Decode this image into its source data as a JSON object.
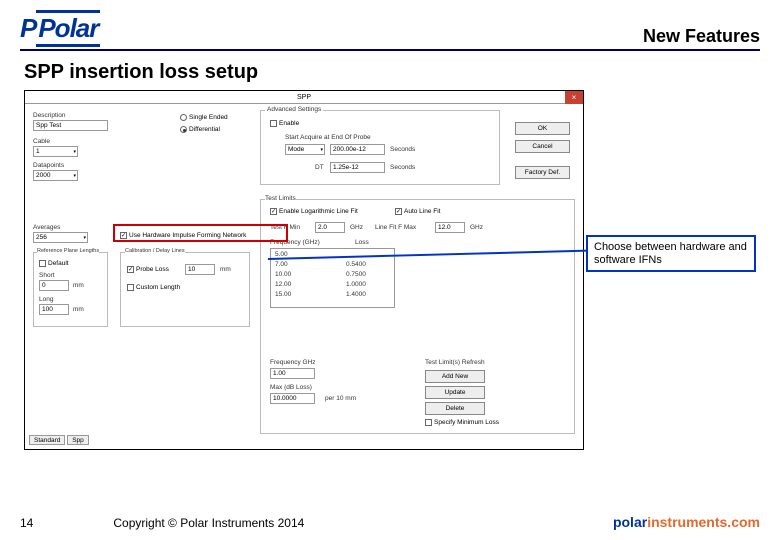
{
  "header": {
    "new_features": "New Features"
  },
  "logo_text": "Polar",
  "title": "SPP insertion loss setup",
  "dialog": {
    "title": "SPP",
    "close": "×",
    "description_label": "Description",
    "description_value": "Spp Test",
    "cable_label": "Cable",
    "cable_value": "1",
    "datapoints_label": "Datapoints",
    "datapoints_value": "2000",
    "radio_single": "Single Ended",
    "radio_diff": "Differential",
    "advanced_group": "Advanced Settings",
    "enable": "Enable",
    "start_acquire": "Start Acquire at End Of Probe",
    "mode_value": "Mode",
    "start_val": "200.00e-12",
    "seconds": "Seconds",
    "dt_label": "DT",
    "dt_value": "1.25e-12",
    "ok": "OK",
    "cancel": "Cancel",
    "factory": "Factory Def.",
    "averages_label": "Averages",
    "averages_value": "256",
    "ifn_check": "Use Hardware Impulse Forming Network",
    "refplane_group": "Reference Plane Lengths",
    "default_chk": "Default",
    "short_lbl": "Short",
    "short_val": "0",
    "long_lbl": "Long",
    "long_val": "100",
    "unit_mm": "mm",
    "calib_group": "Calibration / Delay Lines",
    "probe_loss": "Probe Loss",
    "custom_len": "Custom Length",
    "calib_val": "10",
    "testlimits_group": "Test Limits",
    "enable_logfit": "Enable Logarithmic Line Fit",
    "autoline": "Auto Line Fit",
    "testfmin": "Test F Min",
    "testfmin_val": "2.0",
    "ghz": "GHz",
    "linefitmax": "Line Fit F Max",
    "linefitmax_val": "12.0",
    "freq_col": "Frequency (GHz)",
    "loss_col": "Loss",
    "row1f": "5.00",
    "row1l": "",
    "row2f": "7.00",
    "row2l": "0.5400",
    "row3f": "10.00",
    "row3l": "0.7500",
    "row4f": "12.00",
    "row4l": "1.0000",
    "row5f": "15.00",
    "row5l": "1.4000",
    "freqghz_lbl": "Frequency GHz",
    "freqghz_val": "1.00",
    "maxdb_lbl": "Max (dB Loss)",
    "maxdb_val": "10.0000",
    "per10mm": "per 10 mm",
    "testlimits_refresh": "Test Limit(s) Refresh",
    "addnew": "Add New",
    "update": "Update",
    "delete": "Delete",
    "specmin": "Specify Minimum Loss",
    "tab1": "Standard",
    "tab2": "Spp"
  },
  "callout": "Choose between hardware and software IFNs",
  "page_number": "14",
  "copyright": "Copyright © Polar Instruments 2014",
  "brand_a": "polar",
  "brand_b": "instruments.com"
}
